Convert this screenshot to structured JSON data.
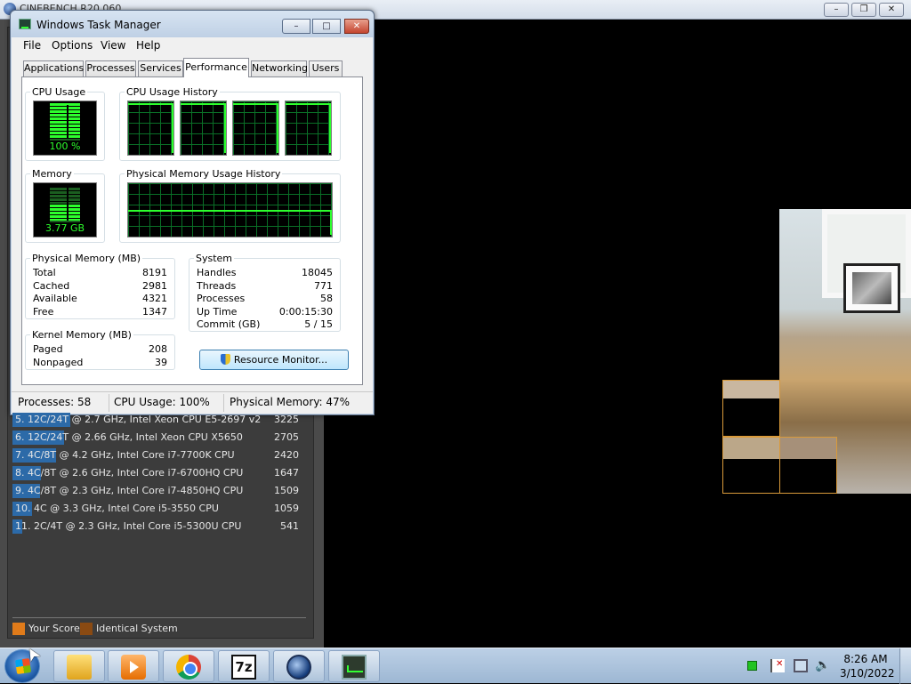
{
  "background_app": {
    "title": "CINEBENCH R20.060",
    "controls": {
      "minimize": "–",
      "maximize": "❐",
      "close": "✕"
    },
    "ranking": [
      {
        "label": "5. 12C/24T @ 2.7 GHz, Intel Xeon CPU E5-2697 v2",
        "score": "3225",
        "fill": 0.2
      },
      {
        "label": "6. 12C/24T @ 2.66 GHz, Intel Xeon CPU X5650",
        "score": "2705",
        "fill": 0.18
      },
      {
        "label": "7. 4C/8T @ 4.2 GHz, Intel Core i7-7700K CPU",
        "score": "2420",
        "fill": 0.15
      },
      {
        "label": "8. 4C/8T @ 2.6 GHz, Intel Core i7-6700HQ CPU",
        "score": "1647",
        "fill": 0.1
      },
      {
        "label": "9. 4C/8T @ 2.3 GHz, Intel Core i7-4850HQ CPU",
        "score": "1509",
        "fill": 0.095
      },
      {
        "label": "10. 4C @ 3.3 GHz, Intel Core i5-3550 CPU",
        "score": "1059",
        "fill": 0.067
      },
      {
        "label": "11. 2C/4T @ 2.3 GHz, Intel Core i5-5300U CPU",
        "score": "541",
        "fill": 0.035
      }
    ],
    "legend": {
      "your_score": "Your Score",
      "identical_system": "Identical System",
      "your_score_color": "#e07b1a",
      "identical_system_color": "#8a4a12"
    }
  },
  "task_manager": {
    "title": "Windows Task Manager",
    "controls": {
      "minimize": "–",
      "maximize": "□",
      "close": "✕"
    },
    "menu": [
      "File",
      "Options",
      "View",
      "Help"
    ],
    "tabs": [
      "Applications",
      "Processes",
      "Services",
      "Performance",
      "Networking",
      "Users"
    ],
    "active_tab": "Performance",
    "cpu_usage": {
      "label": "CPU Usage",
      "value": "100 %",
      "fraction": 1.0
    },
    "cpu_history_label": "CPU Usage History",
    "memory": {
      "label": "Memory",
      "value": "3.77 GB",
      "fraction": 0.47
    },
    "memory_history_label": "Physical Memory Usage History",
    "physical_memory": {
      "label": "Physical Memory (MB)",
      "rows": [
        {
          "key": "Total",
          "value": "8191"
        },
        {
          "key": "Cached",
          "value": "2981"
        },
        {
          "key": "Available",
          "value": "4321"
        },
        {
          "key": "Free",
          "value": "1347"
        }
      ]
    },
    "kernel_memory": {
      "label": "Kernel Memory (MB)",
      "rows": [
        {
          "key": "Paged",
          "value": "208"
        },
        {
          "key": "Nonpaged",
          "value": "39"
        }
      ]
    },
    "system": {
      "label": "System",
      "rows": [
        {
          "key": "Handles",
          "value": "18045"
        },
        {
          "key": "Threads",
          "value": "771"
        },
        {
          "key": "Processes",
          "value": "58"
        },
        {
          "key": "Up Time",
          "value": "0:00:15:30"
        },
        {
          "key": "Commit (GB)",
          "value": "5 / 15"
        }
      ]
    },
    "resource_monitor_button": "Resource Monitor...",
    "status": {
      "processes": "Processes: 58",
      "cpu": "CPU Usage: 100%",
      "memory": "Physical Memory: 47%"
    }
  },
  "taskbar": {
    "apps": [
      "windows-explorer-icon",
      "media-player-icon",
      "chrome-icon",
      "7zip-icon",
      "cinema4d-icon",
      "task-manager-icon"
    ],
    "seven_zip_text": "7z",
    "volume_glyph": "🔈",
    "time": "8:26 AM",
    "date": "3/10/2022"
  },
  "cursor_glyph": "➤"
}
